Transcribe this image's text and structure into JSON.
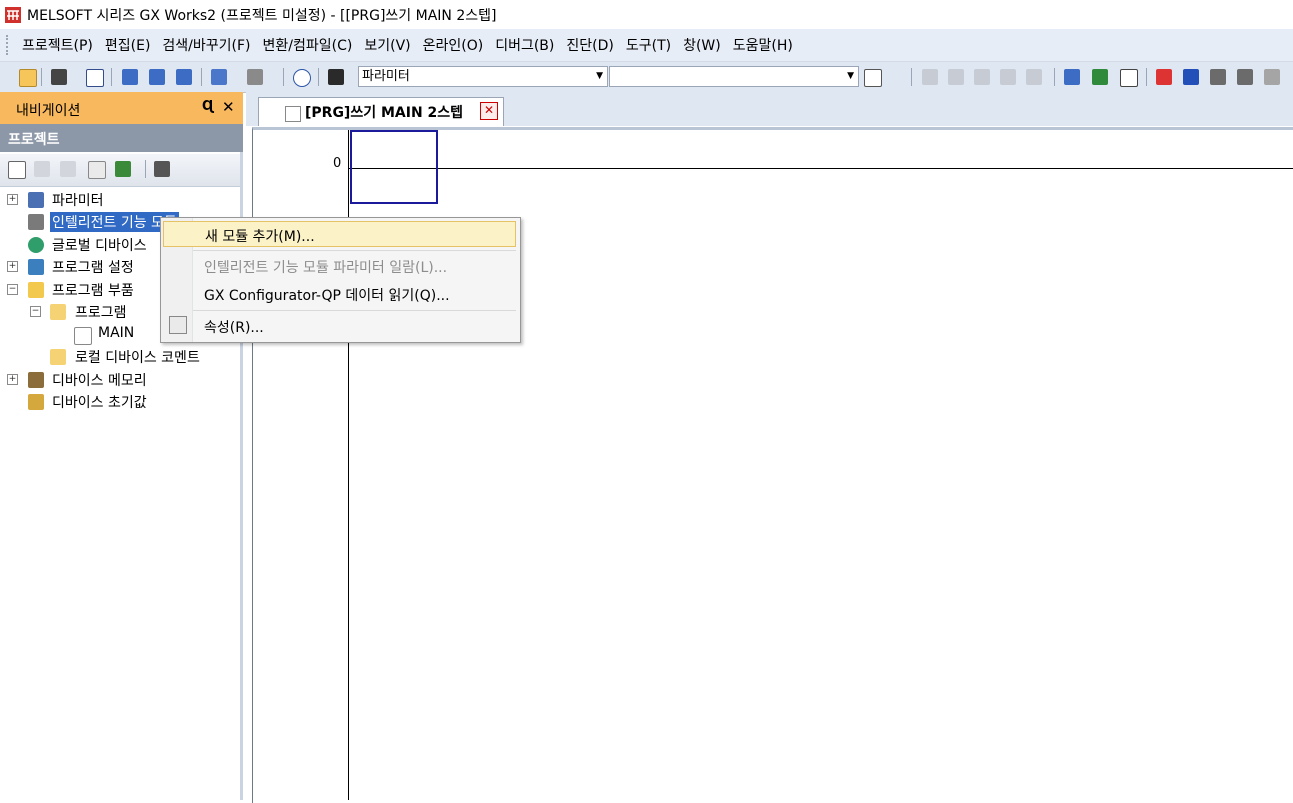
{
  "title_bar": {
    "logo_text": "MEL",
    "title": "MELSOFT 시리즈 GX Works2 (프로젝트 미설정) - [[PRG]쓰기 MAIN 2스텝]"
  },
  "menu": [
    {
      "label": "프로젝트(P)"
    },
    {
      "label": "편집(E)"
    },
    {
      "label": "검색/바꾸기(F)"
    },
    {
      "label": "변환/컴파일(C)"
    },
    {
      "label": "보기(V)"
    },
    {
      "label": "온라인(O)"
    },
    {
      "label": "디버그(B)"
    },
    {
      "label": "진단(D)"
    },
    {
      "label": "도구(T)"
    },
    {
      "label": "창(W)"
    },
    {
      "label": "도움말(H)"
    }
  ],
  "toolbar": {
    "combo1_value": "파라미터",
    "combo2_value": ""
  },
  "nav": {
    "header": "내비게이션",
    "pin": "Ɋ",
    "close": "✕",
    "project_label": "프로젝트",
    "tree": [
      {
        "label": "파라미터"
      },
      {
        "label": "인텔리전트 기능 모듈"
      },
      {
        "label": "글로벌 디바이스"
      },
      {
        "label": "프로그램 설정"
      },
      {
        "label": "프로그램 부품"
      },
      {
        "label": "프로그램"
      },
      {
        "label": "MAIN"
      },
      {
        "label": "로컬 디바이스 코멘트"
      },
      {
        "label": "디바이스 메모리"
      },
      {
        "label": "디바이스 초기값"
      }
    ]
  },
  "editor": {
    "tab_label": "[PRG]쓰기 MAIN 2스텝",
    "tab_close": "✕",
    "rung_number": "0"
  },
  "context_menu": [
    {
      "label": "새 모듈 추가(M)...",
      "state": "highlighted"
    },
    {
      "label": "인텔리전트 기능 모듈 파라미터 일람(L)...",
      "state": "disabled"
    },
    {
      "label": "GX Configurator-QP 데이터 읽기(Q)...",
      "state": "normal"
    },
    {
      "label": "속성(R)...",
      "state": "normal"
    }
  ],
  "colors": {
    "nav_header": "#f8b85e",
    "project_header": "#8c97a8",
    "selection": "#316ac5",
    "menu_highlight": "#fcf2c8"
  }
}
